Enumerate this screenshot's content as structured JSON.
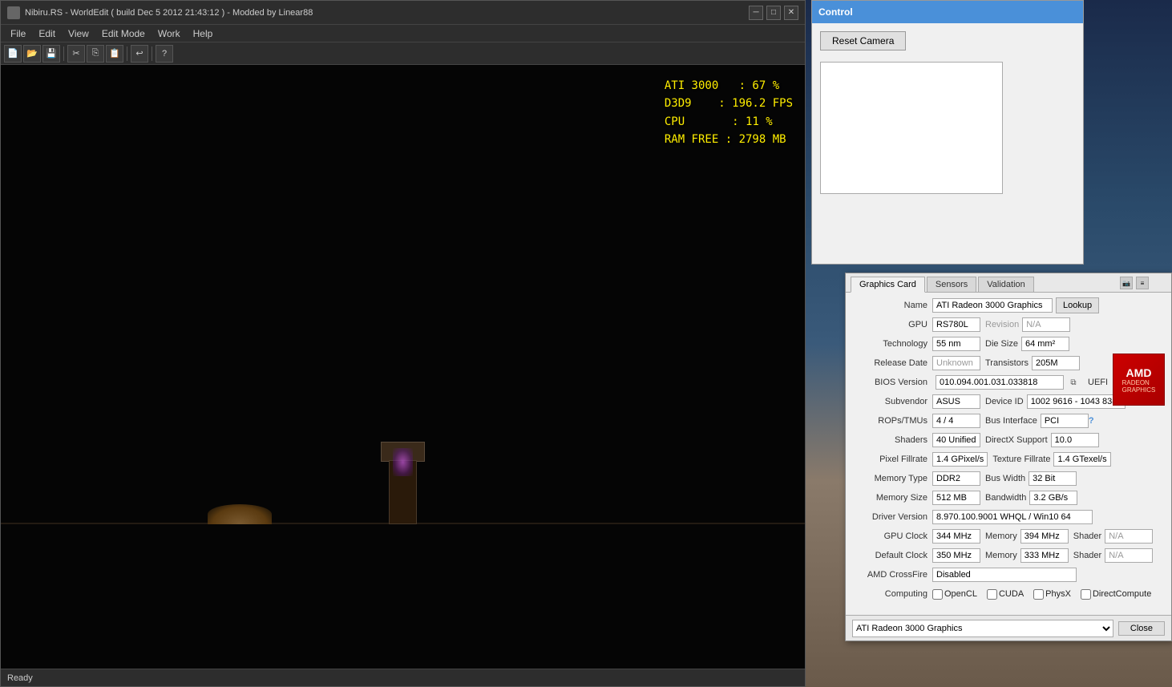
{
  "main_window": {
    "title": "Nibiru.RS - WorldEdit ( build Dec  5 2012 21:43:12 ) - Modded by Linear88",
    "menu": {
      "items": [
        "File",
        "Edit",
        "View",
        "Edit Mode",
        "Work",
        "Help"
      ]
    },
    "toolbar": {
      "buttons": [
        "new",
        "open",
        "save",
        "cut",
        "copy",
        "paste",
        "undo",
        "help"
      ]
    },
    "hud": {
      "ati_label": "ATI 3000",
      "ati_value": ": 67 %",
      "d3d9_label": "D3D9",
      "d3d9_value": ": 196.2 FPS",
      "cpu_label": "CPU",
      "cpu_value": ": 11 %",
      "ram_label": "RAM FREE",
      "ram_value": ": 2798 MB"
    },
    "statusbar": {
      "text": "Ready"
    }
  },
  "control_window": {
    "title": "Control",
    "reset_camera_label": "Reset Camera"
  },
  "gpuz_window": {
    "tabs": [
      "Graphics Card",
      "Sensors",
      "Validation"
    ],
    "active_tab": "Graphics Card",
    "fields": {
      "name_label": "Name",
      "name_value": "ATI Radeon 3000 Graphics",
      "lookup_label": "Lookup",
      "gpu_label": "GPU",
      "gpu_value": "RS780L",
      "revision_label": "Revision",
      "revision_value": "N/A",
      "technology_label": "Technology",
      "technology_value": "55 nm",
      "die_size_label": "Die Size",
      "die_size_value": "64 mm²",
      "release_date_label": "Release Date",
      "release_date_value": "Unknown",
      "transistors_label": "Transistors",
      "transistors_value": "205M",
      "bios_version_label": "BIOS Version",
      "bios_version_value": "010.094.001.031.033818",
      "uefi_label": "UEFI",
      "subvendor_label": "Subvendor",
      "subvendor_value": "ASUS",
      "device_id_label": "Device ID",
      "device_id_value": "1002 9616 - 1043 8388",
      "rops_label": "ROPs/TMUs",
      "rops_value": "4 / 4",
      "bus_interface_label": "Bus Interface",
      "bus_interface_value": "PCI",
      "shaders_label": "Shaders",
      "shaders_value": "40 Unified",
      "directx_support_label": "DirectX Support",
      "directx_support_value": "10.0",
      "pixel_fillrate_label": "Pixel Fillrate",
      "pixel_fillrate_value": "1.4 GPixel/s",
      "texture_fillrate_label": "Texture Fillrate",
      "texture_fillrate_value": "1.4 GTexel/s",
      "memory_type_label": "Memory Type",
      "memory_type_value": "DDR2",
      "bus_width_label": "Bus Width",
      "bus_width_value": "32 Bit",
      "memory_size_label": "Memory Size",
      "memory_size_value": "512 MB",
      "bandwidth_label": "Bandwidth",
      "bandwidth_value": "3.2 GB/s",
      "driver_version_label": "Driver Version",
      "driver_version_value": "8.970.100.9001 WHQL / Win10 64",
      "gpu_clock_label": "GPU Clock",
      "gpu_clock_value": "344 MHz",
      "memory_clock_label": "Memory",
      "memory_clock_value": "394 MHz",
      "shader_label": "Shader",
      "shader_value": "N/A",
      "default_clock_label": "Default Clock",
      "default_clock_value": "350 MHz",
      "default_memory_label": "Memory",
      "default_memory_value": "333 MHz",
      "default_shader_label": "Shader",
      "default_shader_value": "N/A",
      "amd_crossfire_label": "AMD CrossFire",
      "amd_crossfire_value": "Disabled",
      "computing_label": "Computing",
      "opencl_label": "OpenCL",
      "cuda_label": "CUDA",
      "physx_label": "PhysX",
      "directcompute_label": "DirectCompute"
    },
    "footer": {
      "select_value": "ATI Radeon 3000 Graphics",
      "close_label": "Close"
    },
    "amd_logo": {
      "text": "AMD",
      "subtext": "RADEON\nGRAPHICS"
    }
  }
}
